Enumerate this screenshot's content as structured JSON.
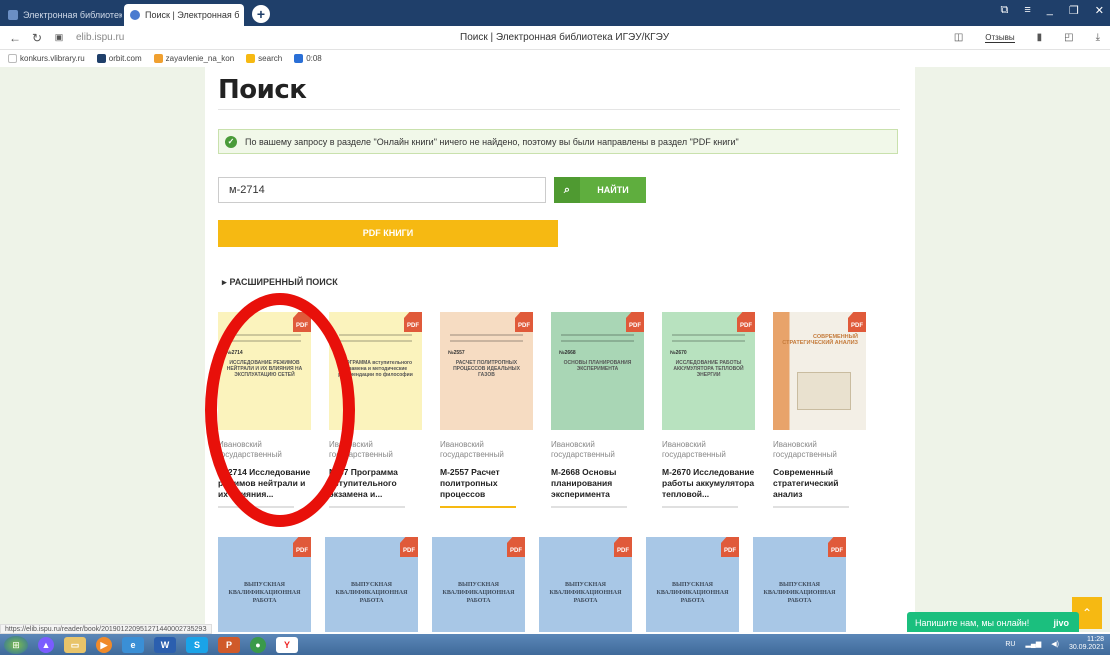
{
  "browser": {
    "tabs": [
      {
        "label": "Электронная библиотека",
        "active": false,
        "color": "#6b8fc4"
      },
      {
        "label": "Поиск | Электронная б",
        "active": true,
        "color": "#4a7bd0"
      }
    ],
    "new_tab": "+",
    "url": "elib.ispu.ru",
    "page_title": "Поиск | Электронная библиотека ИГЭУ/КГЭУ",
    "reviews": "Отзывы",
    "bookmarks": [
      {
        "label": "konkurs.vlibrary.ru",
        "color": "#e9e9e9"
      },
      {
        "label": "orbit.com",
        "color": "#1f3f6a"
      },
      {
        "label": "zayavlenie_na_kon",
        "color": "#f0a030"
      },
      {
        "label": "search",
        "color": "#f6b912"
      },
      {
        "label": "0:08",
        "color": "#2a6fd6"
      }
    ]
  },
  "page": {
    "heading": "Поиск",
    "notice": "По вашему запросу в разделе \"Онлайн книги\" ничего не найдено, поэтому вы были направлены в раздел \"PDF книги\"",
    "search_value": "м-2714",
    "find_label": "НАЙТИ",
    "pdf_books_label": "PDF КНИГИ",
    "advanced_search": "РАСШИРЕННЫЙ ПОИСК",
    "accent_color": "#f6b912",
    "green_color": "#5fae3e"
  },
  "books": [
    {
      "org": "Ивановский государственный",
      "title": "М-2714 Исследование режимов нейтрали и их влияния...",
      "cover_color": "#fbf3bd",
      "code": "№2714",
      "cover_title": "ИССЛЕДОВАНИЕ РЕЖИМОВ НЕЙТРАЛИ И ИХ ВЛИЯНИЯ НА ЭКСПЛУАТАЦИЮ СЕТЕЙ"
    },
    {
      "org": "Ивановский государственный",
      "title": "М-67 Программа вступительного экзамена и...",
      "cover_color": "#fbf3bd",
      "code": "",
      "cover_title": "ПРОГРАММА вступительного экзамена и методические рекомендации по философии"
    },
    {
      "org": "Ивановский государственный",
      "title": "М-2557 Расчет политропных процессов",
      "cover_color": "#f6dcc2",
      "code": "№2557",
      "cover_title": "РАСЧЕТ ПОЛИТРОПНЫХ ПРОЦЕССОВ ИДЕАЛЬНЫХ ГАЗОВ"
    },
    {
      "org": "Ивановский государственный",
      "title": "М-2668 Основы планирования эксперимента",
      "cover_color": "#a9d6b5",
      "code": "№2668",
      "cover_title": "ОСНОВЫ ПЛАНИРОВАНИЯ ЭКСПЕРИМЕНТА"
    },
    {
      "org": "Ивановский государственный",
      "title": "М-2670 Исследование работы аккумулятора тепловой...",
      "cover_color": "#b8e2bf",
      "code": "№2670",
      "cover_title": "ИССЛЕДОВАНИЕ РАБОТЫ АККУМУЛЯТОРА ТЕПЛОВОЙ ЭНЕРГИИ"
    },
    {
      "org": "Ивановский государственный",
      "title": "Современный стратегический анализ",
      "cover_color": "#e8a36a",
      "code": "",
      "cover_title": "СОВРЕМЕННЫЙ СТРАТЕГИЧЕСКИЙ АНАЛИЗ"
    }
  ],
  "vkr_cover_text": "ВЫПУСКНАЯ КВАЛИФИКАЦИОННАЯ РАБОТА",
  "pdf_tag": "PDF",
  "chat": {
    "label": "Напишите нам, мы онлайн!",
    "brand": "jivo"
  },
  "status_url": "https://elib.ispu.ru/reader/book/20190122095127144000273529З",
  "taskbar": {
    "lang": "RU",
    "time": "11:28",
    "date": "30.09.2021"
  },
  "icons": {
    "back": "←",
    "refresh": "↻",
    "lock": "🔒",
    "search": "⌕",
    "triangle": "▸",
    "check": "✓",
    "up": "⌃"
  }
}
